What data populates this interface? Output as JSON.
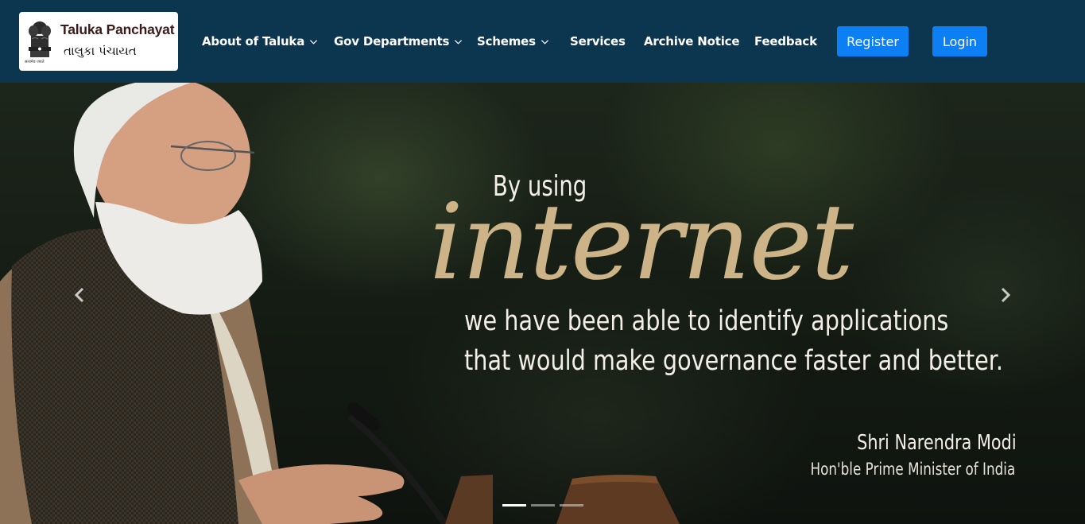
{
  "header": {
    "logo": {
      "title": "Taluka Panchayat",
      "subtitle": "તાલુકા પંચાયત",
      "emblem_caption": "सत्यमेव जयते",
      "icon": "state-emblem-icon"
    },
    "nav": [
      {
        "label": "About of Taluka",
        "has_dropdown": true
      },
      {
        "label": "Gov Departments",
        "has_dropdown": true
      },
      {
        "label": "Schemes",
        "has_dropdown": true
      },
      {
        "label": "Services",
        "has_dropdown": false
      },
      {
        "label": "Archive Notice",
        "has_dropdown": false
      },
      {
        "label": "Feedback",
        "has_dropdown": false
      }
    ],
    "register_label": "Register",
    "login_label": "Login",
    "colors": {
      "header_bg": "#0c3550",
      "button_bg": "#0d7ff5"
    }
  },
  "hero": {
    "slide": {
      "line1": "By using",
      "highlight": "internet",
      "line3": "we have been able to identify applications",
      "line4": "that would make governance faster and better.",
      "attribution_name": "Shri Narendra Modi",
      "attribution_title": "Hon'ble Prime Minister of India"
    },
    "prev_icon": "chevron-left-icon",
    "next_icon": "chevron-right-icon",
    "indicators": {
      "count": 3,
      "active_index": 0
    },
    "colors": {
      "highlight": "#cdb488",
      "text": "#f3efe6"
    }
  }
}
